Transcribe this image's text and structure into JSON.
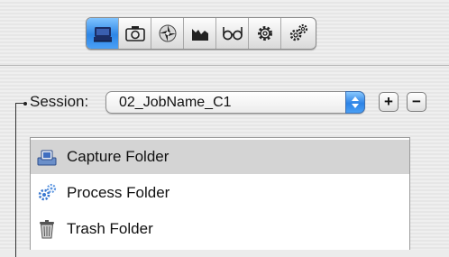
{
  "toolbar": {
    "buttons": [
      {
        "icon": "capture-folder-icon",
        "active": true
      },
      {
        "icon": "camera-icon",
        "active": false
      },
      {
        "icon": "aperture-icon",
        "active": false
      },
      {
        "icon": "histogram-icon",
        "active": false
      },
      {
        "icon": "glasses-icon",
        "active": false
      },
      {
        "icon": "gear-icon",
        "active": false
      },
      {
        "icon": "gears-icon",
        "active": false
      }
    ]
  },
  "session": {
    "label": "Session:",
    "value": "02_JobName_C1",
    "add_label": "+",
    "remove_label": "−"
  },
  "folders": [
    {
      "label": "Capture Folder",
      "icon": "capture-folder-icon",
      "selected": true
    },
    {
      "label": "Process Folder",
      "icon": "process-gears-icon",
      "selected": false
    },
    {
      "label": "Trash Folder",
      "icon": "trash-icon",
      "selected": false
    }
  ],
  "colors": {
    "accent": "#2e86e6",
    "selection": "#d4d4d4"
  }
}
